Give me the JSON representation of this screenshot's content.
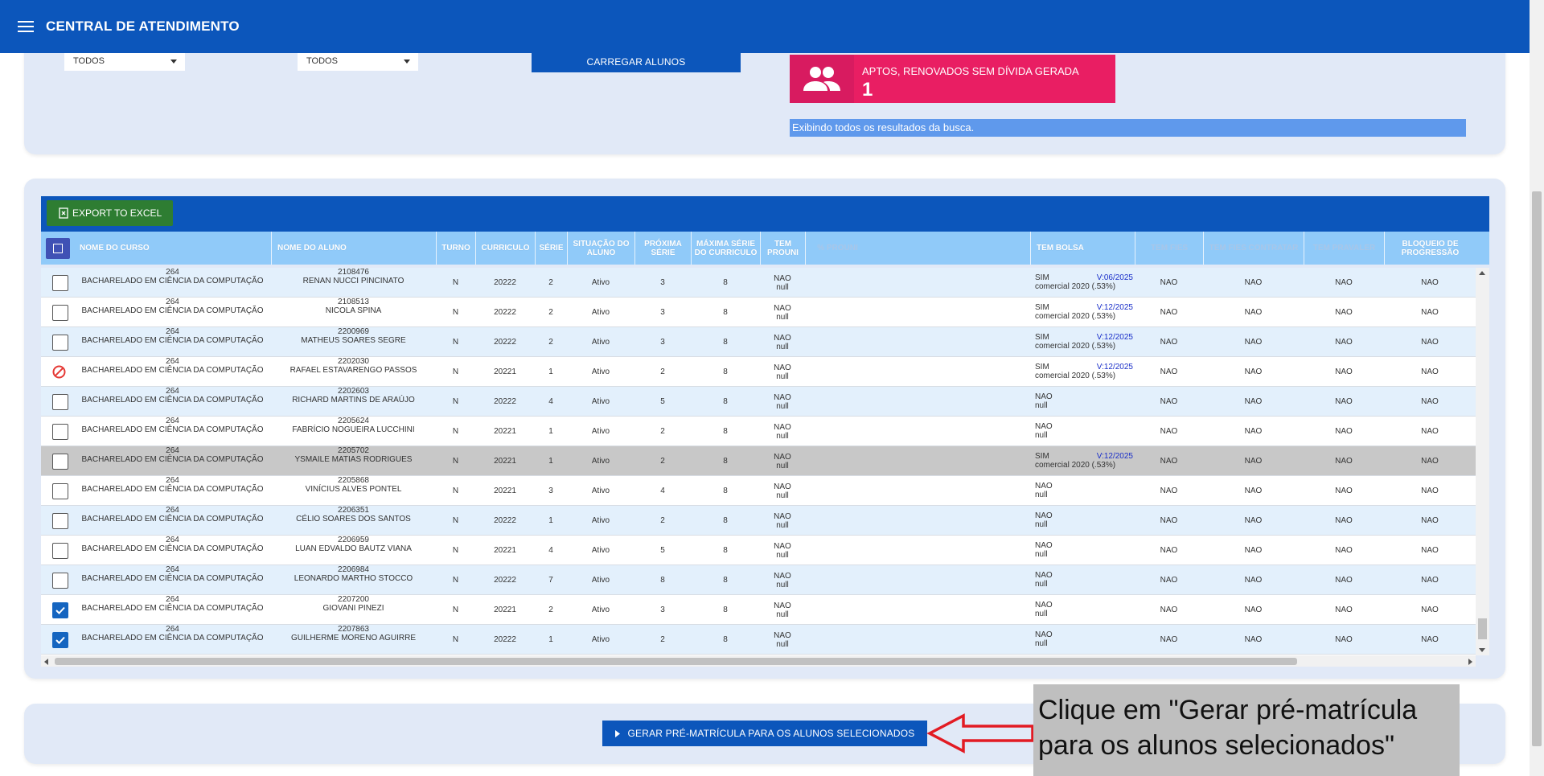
{
  "header": {
    "title": "CENTRAL DE ATENDIMENTO"
  },
  "filters": {
    "select1": "TODOS",
    "select2": "TODOS",
    "load_button": "CARREGAR ALUNOS"
  },
  "status_card": {
    "label": "APTOS, RENOVADOS SEM DÍVIDA GERADA",
    "count": "1",
    "color": "#e91e63"
  },
  "info_bar": "Exibindo todos os resultados da busca.",
  "table": {
    "export_label": "EXPORT TO EXCEL",
    "columns": [
      "NOME DO CURSO",
      "NOME DO ALUNO",
      "TURNO",
      "CURRICULO",
      "SÉRIE",
      "SITUAÇÃO DO ALUNO",
      "PRÓXIMA SÉRIE",
      "MÁXIMA SÉRIE DO CURRICULO",
      "TEM PROUNI",
      "% PROUNI",
      "TEM BOLSA",
      "TEM FIES",
      "TEM FIES CONTRATAR",
      "TEM PRAVALER",
      "BLOQUEIO DE PROGRESSÃO"
    ],
    "rows": [
      {
        "state": "unchecked",
        "course_code": "264",
        "course_name": "BACHARELADO EM CIÊNCIA DA COMPUTAÇÃO",
        "student_id": "2108476",
        "student_name": "RENAN NUCCI PINCINATO",
        "turno": "N",
        "curriculo": "20222",
        "serie": "2",
        "situacao": "Ativo",
        "proxima": "3",
        "maxima": "8",
        "prouni": "NAO",
        "prouni_sub": "null",
        "bolsa": "SIM",
        "bolsa_sub": "comercial 2020 (.53%)",
        "bolsa_validity": "V:06/2025",
        "fies": "NAO",
        "fies_contratar": "NAO",
        "pravaler": "NAO",
        "bloqueio": "NAO"
      },
      {
        "state": "unchecked",
        "course_code": "264",
        "course_name": "BACHARELADO EM CIÊNCIA DA COMPUTAÇÃO",
        "student_id": "2108513",
        "student_name": "NICOLA SPINA",
        "turno": "N",
        "curriculo": "20222",
        "serie": "2",
        "situacao": "Ativo",
        "proxima": "3",
        "maxima": "8",
        "prouni": "NAO",
        "prouni_sub": "null",
        "bolsa": "SIM",
        "bolsa_sub": "comercial 2020 (.53%)",
        "bolsa_validity": "V:12/2025",
        "fies": "NAO",
        "fies_contratar": "NAO",
        "pravaler": "NAO",
        "bloqueio": "NAO"
      },
      {
        "state": "unchecked",
        "course_code": "264",
        "course_name": "BACHARELADO EM CIÊNCIA DA COMPUTAÇÃO",
        "student_id": "2200969",
        "student_name": "MATHEUS SOARES SEGRE",
        "turno": "N",
        "curriculo": "20222",
        "serie": "2",
        "situacao": "Ativo",
        "proxima": "3",
        "maxima": "8",
        "prouni": "NAO",
        "prouni_sub": "null",
        "bolsa": "SIM",
        "bolsa_sub": "comercial 2020 (.53%)",
        "bolsa_validity": "V:12/2025",
        "fies": "NAO",
        "fies_contratar": "NAO",
        "pravaler": "NAO",
        "bloqueio": "NAO"
      },
      {
        "state": "blocked",
        "course_code": "264",
        "course_name": "BACHARELADO EM CIÊNCIA DA COMPUTAÇÃO",
        "student_id": "2202030",
        "student_name": "RAFAEL ESTAVARENGO PASSOS",
        "turno": "N",
        "curriculo": "20221",
        "serie": "1",
        "situacao": "Ativo",
        "proxima": "2",
        "maxima": "8",
        "prouni": "NAO",
        "prouni_sub": "null",
        "bolsa": "SIM",
        "bolsa_sub": "comercial 2020 (.53%)",
        "bolsa_validity": "V:12/2025",
        "fies": "NAO",
        "fies_contratar": "NAO",
        "pravaler": "NAO",
        "bloqueio": "NAO"
      },
      {
        "state": "unchecked",
        "course_code": "264",
        "course_name": "BACHARELADO EM CIÊNCIA DA COMPUTAÇÃO",
        "student_id": "2202603",
        "student_name": "RICHARD MARTINS DE ARAÚJO",
        "turno": "N",
        "curriculo": "20222",
        "serie": "4",
        "situacao": "Ativo",
        "proxima": "5",
        "maxima": "8",
        "prouni": "NAO",
        "prouni_sub": "null",
        "bolsa": "NAO",
        "bolsa_sub": "null",
        "bolsa_validity": "",
        "fies": "NAO",
        "fies_contratar": "NAO",
        "pravaler": "NAO",
        "bloqueio": "NAO"
      },
      {
        "state": "unchecked",
        "course_code": "264",
        "course_name": "BACHARELADO EM CIÊNCIA DA COMPUTAÇÃO",
        "student_id": "2205624",
        "student_name": "FABRÍCIO NOGUEIRA LUCCHINI",
        "turno": "N",
        "curriculo": "20221",
        "serie": "1",
        "situacao": "Ativo",
        "proxima": "2",
        "maxima": "8",
        "prouni": "NAO",
        "prouni_sub": "null",
        "bolsa": "NAO",
        "bolsa_sub": "null",
        "bolsa_validity": "",
        "fies": "NAO",
        "fies_contratar": "NAO",
        "pravaler": "NAO",
        "bloqueio": "NAO"
      },
      {
        "state": "unchecked",
        "course_code": "264",
        "course_name": "BACHARELADO EM CIÊNCIA DA COMPUTAÇÃO",
        "student_id": "2205702",
        "student_name": "YSMAILE MATIAS RODRIGUES",
        "turno": "N",
        "curriculo": "20221",
        "serie": "1",
        "situacao": "Ativo",
        "proxima": "2",
        "maxima": "8",
        "prouni": "NAO",
        "prouni_sub": "null",
        "bolsa": "SIM",
        "bolsa_sub": "comercial 2020 (.53%)",
        "bolsa_validity": "V:12/2025",
        "fies": "NAO",
        "fies_contratar": "NAO",
        "pravaler": "NAO",
        "bloqueio": "NAO"
      },
      {
        "state": "unchecked",
        "course_code": "264",
        "course_name": "BACHARELADO EM CIÊNCIA DA COMPUTAÇÃO",
        "student_id": "2205868",
        "student_name": "VINÍCIUS ALVES PONTEL",
        "turno": "N",
        "curriculo": "20221",
        "serie": "3",
        "situacao": "Ativo",
        "proxima": "4",
        "maxima": "8",
        "prouni": "NAO",
        "prouni_sub": "null",
        "bolsa": "NAO",
        "bolsa_sub": "null",
        "bolsa_validity": "",
        "fies": "NAO",
        "fies_contratar": "NAO",
        "pravaler": "NAO",
        "bloqueio": "NAO"
      },
      {
        "state": "unchecked",
        "course_code": "264",
        "course_name": "BACHARELADO EM CIÊNCIA DA COMPUTAÇÃO",
        "student_id": "2206351",
        "student_name": "CÉLIO SOARES DOS SANTOS",
        "turno": "N",
        "curriculo": "20222",
        "serie": "1",
        "situacao": "Ativo",
        "proxima": "2",
        "maxima": "8",
        "prouni": "NAO",
        "prouni_sub": "null",
        "bolsa": "NAO",
        "bolsa_sub": "null",
        "bolsa_validity": "",
        "fies": "NAO",
        "fies_contratar": "NAO",
        "pravaler": "NAO",
        "bloqueio": "NAO"
      },
      {
        "state": "unchecked",
        "course_code": "264",
        "course_name": "BACHARELADO EM CIÊNCIA DA COMPUTAÇÃO",
        "student_id": "2206959",
        "student_name": "LUAN EDVALDO BAUTZ VIANA",
        "turno": "N",
        "curriculo": "20221",
        "serie": "4",
        "situacao": "Ativo",
        "proxima": "5",
        "maxima": "8",
        "prouni": "NAO",
        "prouni_sub": "null",
        "bolsa": "NAO",
        "bolsa_sub": "null",
        "bolsa_validity": "",
        "fies": "NAO",
        "fies_contratar": "NAO",
        "pravaler": "NAO",
        "bloqueio": "NAO"
      },
      {
        "state": "unchecked",
        "course_code": "264",
        "course_name": "BACHARELADO EM CIÊNCIA DA COMPUTAÇÃO",
        "student_id": "2206984",
        "student_name": "LEONARDO MARTHO STOCCO",
        "turno": "N",
        "curriculo": "20222",
        "serie": "7",
        "situacao": "Ativo",
        "proxima": "8",
        "maxima": "8",
        "prouni": "NAO",
        "prouni_sub": "null",
        "bolsa": "NAO",
        "bolsa_sub": "null",
        "bolsa_validity": "",
        "fies": "NAO",
        "fies_contratar": "NAO",
        "pravaler": "NAO",
        "bloqueio": "NAO"
      },
      {
        "state": "checked",
        "course_code": "264",
        "course_name": "BACHARELADO EM CIÊNCIA DA COMPUTAÇÃO",
        "student_id": "2207200",
        "student_name": "GIOVANI PINEZI",
        "turno": "N",
        "curriculo": "20221",
        "serie": "2",
        "situacao": "Ativo",
        "proxima": "3",
        "maxima": "8",
        "prouni": "NAO",
        "prouni_sub": "null",
        "bolsa": "NAO",
        "bolsa_sub": "null",
        "bolsa_validity": "",
        "fies": "NAO",
        "fies_contratar": "NAO",
        "pravaler": "NAO",
        "bloqueio": "NAO"
      },
      {
        "state": "checked",
        "course_code": "264",
        "course_name": "BACHARELADO EM CIÊNCIA DA COMPUTAÇÃO",
        "student_id": "2207863",
        "student_name": "GUILHERME MORENO AGUIRRE",
        "turno": "N",
        "curriculo": "20222",
        "serie": "1",
        "situacao": "Ativo",
        "proxima": "2",
        "maxima": "8",
        "prouni": "NAO",
        "prouni_sub": "null",
        "bolsa": "NAO",
        "bolsa_sub": "null",
        "bolsa_validity": "",
        "fies": "NAO",
        "fies_contratar": "NAO",
        "pravaler": "NAO",
        "bloqueio": "NAO"
      }
    ]
  },
  "action": {
    "generate_button": "GERAR PRÉ-MATRÍCULA PARA OS ALUNOS SELECIONADOS"
  },
  "callout": {
    "text": "Clique em \"Gerar pré-matrícula para os alunos selecionados\""
  },
  "colors": {
    "primary": "#0c56bb",
    "header_row": "#90caf9",
    "excel": "#2e7d32",
    "highlight_row": "#c8c8c8",
    "blocked_icon": "#e53935"
  }
}
